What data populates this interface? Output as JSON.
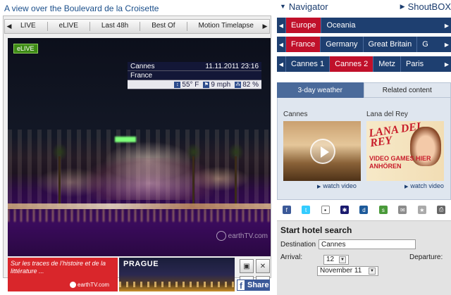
{
  "page_title": "A view over the Boulevard de la Croisette",
  "player": {
    "tabs": [
      "LIVE",
      "eLIVE",
      "Last 48h",
      "Best Of",
      "Motion Timelapse"
    ],
    "badge": "eLIVE",
    "info": {
      "city": "Cannes",
      "datetime": "11.11.2011  23:16",
      "country": "France",
      "temperature": "55° F",
      "wind": "9 mph",
      "humidity": "82 %"
    },
    "watermark": "earthTV.com",
    "ad": {
      "tagline": "Sur les traces de l’histoire et de la littérature ...",
      "logo": "earthTV.com",
      "city": "PRAGUE"
    },
    "share_label": "Share"
  },
  "navigator": {
    "title": "Navigator",
    "shoutbox": "ShoutBOX",
    "regions": [
      {
        "label": "Europe",
        "active": true
      },
      {
        "label": "Oceania",
        "active": false
      }
    ],
    "countries": [
      {
        "label": "France",
        "active": true
      },
      {
        "label": "Germany",
        "active": false
      },
      {
        "label": "Great Britain",
        "active": false
      },
      {
        "label": "G",
        "active": false
      }
    ],
    "cities": [
      {
        "label": "Cannes 1",
        "active": false
      },
      {
        "label": "Cannes 2",
        "active": true
      },
      {
        "label": "Metz",
        "active": false
      },
      {
        "label": "Paris",
        "active": false
      }
    ]
  },
  "content_tabs": {
    "weather": "3-day weather",
    "related": "Related content"
  },
  "related": [
    {
      "caption": "Cannes",
      "link": "watch video"
    },
    {
      "caption": "Lana del Rey",
      "link": "watch video",
      "thumb_logo": "LANA DEL REY",
      "thumb_text": "VIDEO GAMES HIER ANHÖREN"
    }
  ],
  "share_icons": [
    "facebook-icon",
    "twitter-icon",
    "delicious-icon",
    "myspace-icon",
    "digg-icon",
    "stumble-icon",
    "email-icon",
    "bookmark-icon",
    "print-icon"
  ],
  "hotel": {
    "title": "Start hotel search",
    "destination_label": "Destination",
    "destination_value": "Cannes",
    "arrival_label": "Arrival:",
    "departure_label": "Departure:",
    "arrival_day": "12",
    "arrival_month": "November 11"
  },
  "colors": {
    "nav_blue": "#1e3f70",
    "active_red": "#c0102a",
    "link_blue": "#1a3c6e"
  }
}
